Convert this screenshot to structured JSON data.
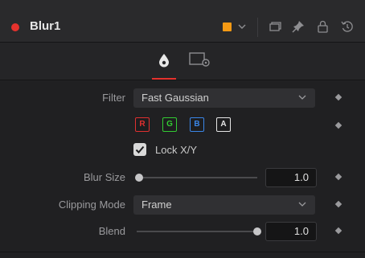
{
  "node": {
    "title": "Blur1",
    "color_swatch": "#f59a14",
    "status_dot_color": "#e5322d",
    "header_icons": [
      "color-chevron-icon",
      "versions-icon",
      "pin-icon",
      "lock-icon",
      "reset-icon"
    ]
  },
  "tabs": [
    {
      "name": "controls-tab",
      "icon": "drop-icon",
      "active": true
    },
    {
      "name": "settings-tab",
      "icon": "settings-gear-icon",
      "active": false
    }
  ],
  "controls": {
    "filter": {
      "label": "Filter",
      "value": "Fast Gaussian"
    },
    "channels": [
      {
        "letter": "R",
        "color": "#e03030"
      },
      {
        "letter": "G",
        "color": "#33cc33"
      },
      {
        "letter": "B",
        "color": "#3a86e8"
      },
      {
        "letter": "A",
        "color": "#e6e6e6"
      }
    ],
    "lock_xy": {
      "label": "Lock X/Y",
      "checked": true
    },
    "blur_size": {
      "label": "Blur Size",
      "value": "1.0",
      "slider_fraction": 0.02
    },
    "clipping_mode": {
      "label": "Clipping Mode",
      "value": "Frame"
    },
    "blend": {
      "label": "Blend",
      "value": "1.0",
      "slider_fraction": 1.0
    }
  }
}
